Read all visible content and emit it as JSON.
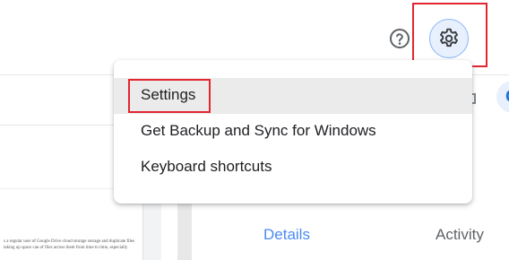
{
  "header": {
    "help_icon": "help-circle-icon",
    "settings_icon": "gear-icon"
  },
  "menu": {
    "items": [
      {
        "label": "Settings"
      },
      {
        "label": "Get Backup and Sync for Windows"
      },
      {
        "label": "Keyboard shortcuts"
      }
    ]
  },
  "details_panel": {
    "tabs": [
      {
        "label": "Details"
      },
      {
        "label": "Activity"
      }
    ]
  },
  "toolbar": {
    "grid_icon": "grid-view-icon",
    "avatar_letter": "G"
  },
  "document_preview": {
    "text": "s a regular user of Google Drive cloud storage storage and duplicate files taking up space can of files across them from time to time, especially"
  },
  "colors": {
    "accent": "#1a73e8",
    "tab_active": "#4a8bf2",
    "highlight_box": "#e3262f",
    "gear_bg": "#e8f0fe",
    "menu_active_bg": "#ebebeb"
  }
}
